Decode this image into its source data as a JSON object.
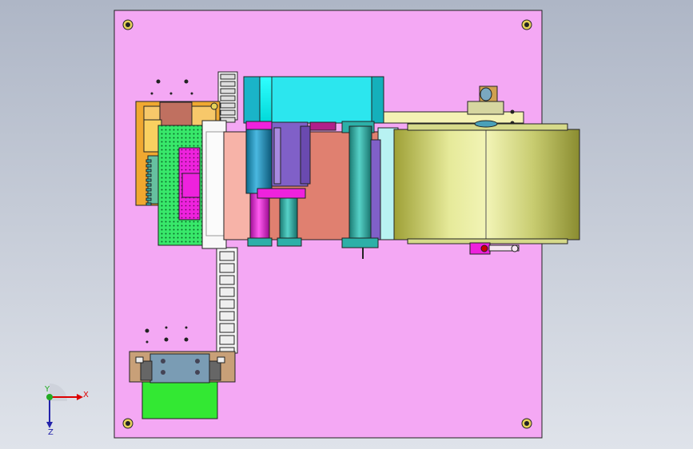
{
  "viewport": {
    "background_top": "#aeb6c6",
    "background_bottom": "#dfe3ea"
  },
  "colors": {
    "base_plate": "#f4a8f4",
    "cyan": "#00f2f2",
    "salmon": "#e08070",
    "olive": "#c8cc70",
    "green": "#38e86a",
    "magenta": "#ee22dd",
    "teal": "#2cb0a8",
    "purple": "#8060c8",
    "tan": "#c8a078",
    "blue_grey": "#7a9cb4",
    "orange": "#f0a830"
  },
  "triad": {
    "x_label": "X",
    "y_label": "Y",
    "z_label": "Z"
  },
  "parts": {
    "base_plate": "base-plate",
    "dispenser_roll": "adhesive-tape-roll",
    "feed_chain": "cable-drag-chain",
    "cylinder": "pneumatic-cylinder",
    "clamp_block": "clamp-block"
  }
}
